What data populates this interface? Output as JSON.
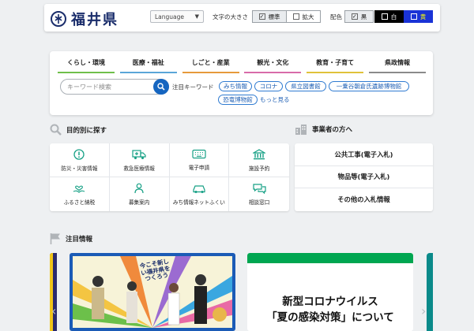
{
  "header": {
    "logo_text": "福井県",
    "language_label": "Language",
    "font_size_label": "文字の大きさ",
    "font_standard": "標準",
    "font_large": "拡大",
    "color_label": "配色",
    "color_black_label": "黒",
    "color_white_label": "白",
    "color_yellow_label": "黄",
    "icons": {
      "logo": "prefecture-emblem-icon",
      "caret": "chevron-down-icon",
      "checkbox": "checkbox-icon"
    }
  },
  "nav": {
    "tabs": [
      {
        "label": "くらし・環境"
      },
      {
        "label": "医療・福祉"
      },
      {
        "label": "しごと・産業"
      },
      {
        "label": "観光・文化"
      },
      {
        "label": "教育・子育て"
      },
      {
        "label": "県政情報"
      }
    ],
    "search_placeholder": "キーワード検索",
    "keyword_label": "注目キーワード",
    "keywords": [
      "みち情報",
      "コロナ",
      "県立図書館",
      "一乗谷朝倉氏遺跡博物館",
      "恐竜博物館"
    ],
    "more_label": "もっと見る"
  },
  "purpose": {
    "title": "目的別に探す",
    "items": [
      {
        "label": "防災・災害情報",
        "icon": "alert-icon"
      },
      {
        "label": "救急医療情報",
        "icon": "ambulance-icon"
      },
      {
        "label": "電子申請",
        "icon": "keyboard-icon"
      },
      {
        "label": "施設予約",
        "icon": "facility-icon"
      },
      {
        "label": "ふるさと納税",
        "icon": "heart-hand-icon"
      },
      {
        "label": "募集案内",
        "icon": "person-icon"
      },
      {
        "label": "みち情報ネットふくい",
        "icon": "car-icon"
      },
      {
        "label": "相談窓口",
        "icon": "chat-icon"
      }
    ]
  },
  "business": {
    "title": "事業者の方へ",
    "items": [
      {
        "label": "公共工事(電子入札)"
      },
      {
        "label": "物品等(電子入札)"
      },
      {
        "label": "その他の入札情報"
      }
    ]
  },
  "featured": {
    "title": "注目情報",
    "banner1_text": "今こそ新しい福井県をつくろう",
    "banner2_line1": "新型コロナウイルス",
    "banner2_line2": "「夏の感染対策」について"
  },
  "colors": {
    "brand": "#1a2d6b",
    "accent": "#1565c0",
    "green": "#00a651",
    "icon": "#16a085"
  }
}
